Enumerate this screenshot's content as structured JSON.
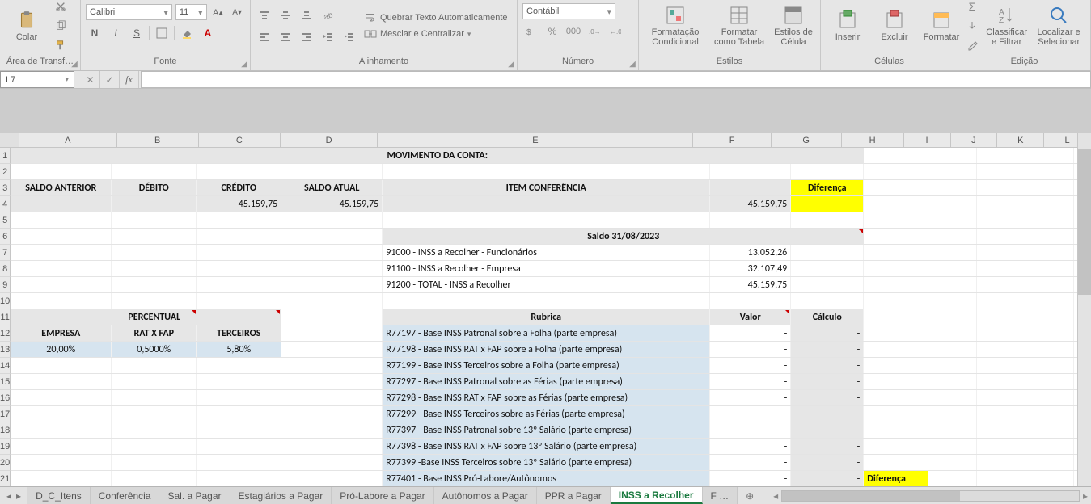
{
  "ribbon": {
    "clipboard": {
      "paste": "Colar",
      "group": "Área de Transf…"
    },
    "font": {
      "name": "Calibri",
      "size": "11",
      "group": "Fonte",
      "btn_bold": "N",
      "btn_italic": "I",
      "btn_underline": "S"
    },
    "alignment": {
      "wrap": "Quebrar Texto Automaticamente",
      "merge": "Mesclar e Centralizar",
      "group": "Alinhamento"
    },
    "number": {
      "format": "Contábil",
      "group": "Número"
    },
    "styles": {
      "cond": "Formatação Condicional",
      "table": "Formatar como Tabela",
      "cell": "Estilos de Célula",
      "group": "Estilos"
    },
    "cells": {
      "insert": "Inserir",
      "delete": "Excluir",
      "format": "Formatar",
      "group": "Células"
    },
    "editing": {
      "sort": "Classificar e Filtrar",
      "find": "Localizar e Selecionar",
      "group": "Edição"
    }
  },
  "namebox": "L7",
  "columns": [
    "A",
    "B",
    "C",
    "D",
    "E",
    "F",
    "G",
    "H",
    "I",
    "J",
    "K",
    "L"
  ],
  "headers": {
    "title": "MOVIMENTO DA CONTA:",
    "saldo_anterior": "SALDO ANTERIOR",
    "debito": "DÉBITO",
    "credito": "CRÉDITO",
    "saldo_atual": "SALDO ATUAL",
    "item_conf": "ITEM CONFERÊNCIA",
    "diferenca": "Diferença"
  },
  "row4": {
    "a": "-",
    "b": "-",
    "c": "45.159,75",
    "d": "45.159,75",
    "f": "45.159,75",
    "g": "-"
  },
  "saldo_title": "Saldo 31/08/2023",
  "saldos": [
    {
      "label": "91000 - INSS a Recolher - Funcionários",
      "value": "13.052,26"
    },
    {
      "label": "91100 - INSS a Recolher - Empresa",
      "value": "32.107,49"
    },
    {
      "label": "91200 - TOTAL - INSS a Recolher",
      "value": "45.159,75"
    }
  ],
  "percentual_title": "PERCENTUAL",
  "perc_headers": {
    "empresa": "EMPRESA",
    "rat": "RAT X FAP",
    "terc": "TERCEIROS"
  },
  "perc_values": {
    "empresa": "20,00%",
    "rat": "0,5000%",
    "terc": "5,80%"
  },
  "rubrica_hdr": {
    "rubrica": "Rubrica",
    "valor": "Valor",
    "calculo": "Cálculo"
  },
  "rubricas": [
    "R77197 - Base INSS Patronal sobre a Folha (parte empresa)",
    "R77198 - Base INSS RAT x FAP sobre a Folha (parte empresa)",
    "R77199 - Base INSS Terceiros sobre a Folha (parte empresa)",
    "R77297 - Base INSS Patronal sobre as Férias (parte empresa)",
    "R77298 - Base INSS RAT x FAP sobre as Férias (parte empresa)",
    "R77299 - Base INSS Terceiros sobre as Férias (parte empresa)",
    "R77397 - Base INSS Patronal sobre 13º Salário (parte empresa)",
    "R77398 - Base INSS RAT x FAP sobre 13º Salário (parte empresa)",
    "R77399 -Base INSS Terceiros sobre 13º Salário (parte empresa)",
    "R77401 - Base INSS Pró-Labore/Autônomos"
  ],
  "dash": "-",
  "diferenca_bottom": "Diferença",
  "tabs": {
    "list": [
      "D_C_Itens",
      "Conferência",
      "Sal. a Pagar",
      "Estagiários a Pagar",
      "Pró-Labore a Pagar",
      "Autônomos a Pagar",
      "PPR a Pagar",
      "INSS a Recolher",
      "F …"
    ],
    "active": "INSS a Recolher"
  }
}
